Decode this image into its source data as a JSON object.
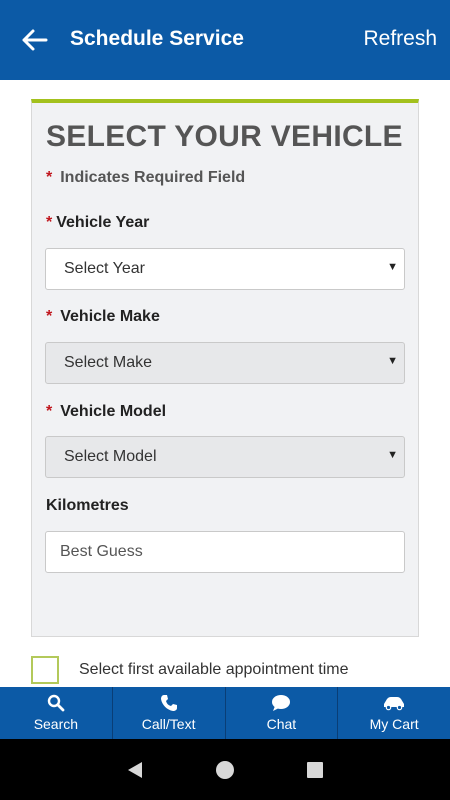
{
  "header": {
    "title": "Schedule Service",
    "refresh_label": "Refresh"
  },
  "form": {
    "heading": "SELECT YOUR VEHICLE",
    "required_marker": "*",
    "required_note": "Indicates Required Field",
    "fields": {
      "year": {
        "label": "Vehicle Year",
        "value": "Select Year"
      },
      "make": {
        "label": "Vehicle Make",
        "value": "Select Make"
      },
      "model": {
        "label": "Vehicle Model",
        "value": "Select Model"
      },
      "kilometres": {
        "label": "Kilometres",
        "placeholder": "Best Guess"
      }
    },
    "checkbox_label": "Select first available appointment time"
  },
  "bottom_nav": {
    "items": [
      {
        "label": "Search",
        "icon": "search-icon"
      },
      {
        "label": "Call/Text",
        "icon": "phone-icon"
      },
      {
        "label": "Chat",
        "icon": "chat-icon"
      },
      {
        "label": "My Cart",
        "icon": "car-icon"
      }
    ]
  },
  "colors": {
    "primary": "#0c5aa6",
    "accent": "#a3c11d",
    "required": "#c0161d"
  }
}
